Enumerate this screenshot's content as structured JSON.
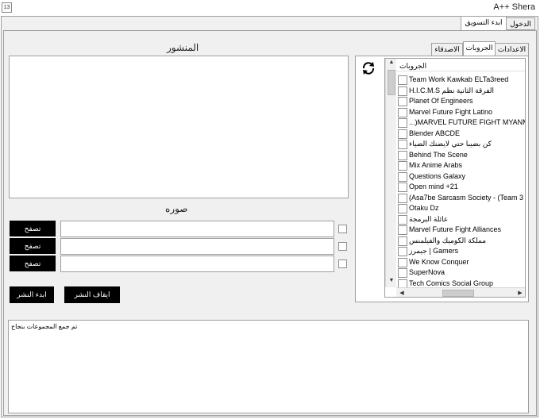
{
  "window": {
    "title": "A++ Shera",
    "system_icon": "13"
  },
  "top_tabs": [
    {
      "label": "الدخول"
    },
    {
      "label": "ابدء التسويق"
    }
  ],
  "post_panel": {
    "heading": "المنشور",
    "image_heading": "صوره",
    "browse_label": "تصفح",
    "start_label": "ابدء النشر",
    "stop_label": "ايقاف النشر"
  },
  "sub_tabs": [
    {
      "label": "الاعدادات"
    },
    {
      "label": "الجروبات"
    },
    {
      "label": "الاصدقاء"
    }
  ],
  "groups": {
    "column_header": "الجروبات",
    "items": [
      "Team Work Kawkab ELTa3reed",
      "H.I.C.M.S الفرقة الثانية نظم",
      "Planet Of Engineers",
      "Marvel Future Fight Latino",
      "...)MARVEL FUTURE FIGHT MYANMAR",
      "Blender ABCDE",
      "كن بضيبا حتي لايضنك الضياء",
      "Behind The Scene",
      "Mix Anime Arabs",
      "Questions Galaxy",
      "Open mind +21",
      "(Asa7be Sarcasm Society - (Team 3",
      "Otaku Dz",
      "عائلة البرمجة",
      "Marvel Future Fight Alliances",
      "مملكة الكوميك والفيلمنس",
      "جيمرز | Gamers",
      "We Know Conquer",
      "SuperNova",
      "Tech Comics Social Group"
    ]
  },
  "status": {
    "text": "تم جمع المجموعات بنجاح"
  }
}
